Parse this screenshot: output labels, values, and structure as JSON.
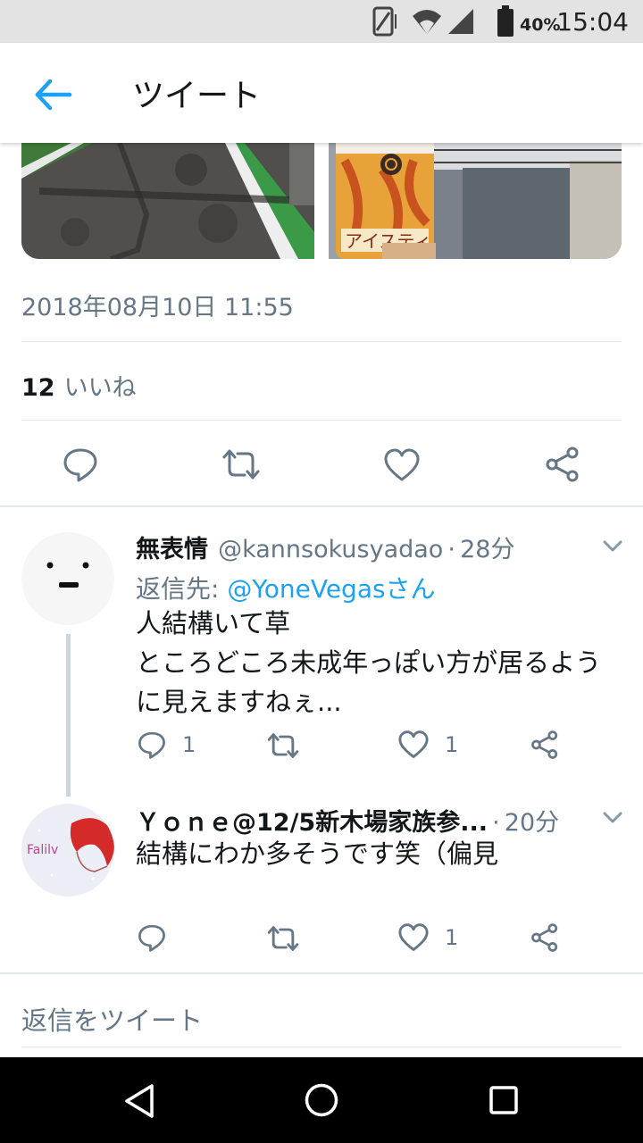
{
  "status_bar": {
    "battery_percent": "40%",
    "time": "15:04"
  },
  "app_bar": {
    "title": "ツイート"
  },
  "tweet": {
    "timestamp": "2018年08月10日 11:55",
    "likes_count": "12",
    "likes_label": "いいね",
    "image_text": "アイスティ"
  },
  "replies": [
    {
      "name": "無表情",
      "handle": "@kannsokusyadao",
      "time_sep": "·",
      "time": "28分",
      "reply_to_label": "返信先:",
      "reply_to_user": "@YoneVegasさん",
      "body_lines": [
        "人結構いて草",
        "ところどころ未成年っぽい方が居るよう",
        "に見えますねぇ..."
      ],
      "reply_count": "1",
      "like_count": "1"
    },
    {
      "name": "Ｙｏｎｅ@12/5新木場家族参...",
      "time_sep": "·",
      "time": "20分",
      "body_lines": [
        "結構にわか多そうです笑（偏見"
      ],
      "avatar_text": "Falilv",
      "like_count": "1"
    }
  ],
  "compose": {
    "placeholder": "返信をツイート"
  },
  "colors": {
    "accent": "#1da1f2",
    "muted": "#657786",
    "divider": "#e1e8ed"
  }
}
